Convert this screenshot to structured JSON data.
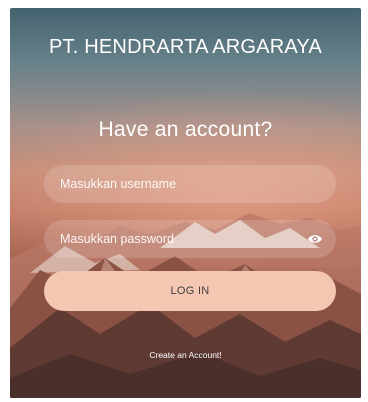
{
  "header": {
    "company_name": "PT. HENDRARTA ARGARAYA"
  },
  "form": {
    "heading": "Have an account?",
    "username_placeholder": "Masukkan username",
    "password_placeholder": "Masukkan password",
    "login_label": "LOG IN",
    "create_account_link": "Create an Account!"
  },
  "icons": {
    "password_toggle": "eye-icon"
  },
  "colors": {
    "button_bg": "#f4c7b3",
    "button_text": "#3f3f3f",
    "text": "#ffffff"
  }
}
